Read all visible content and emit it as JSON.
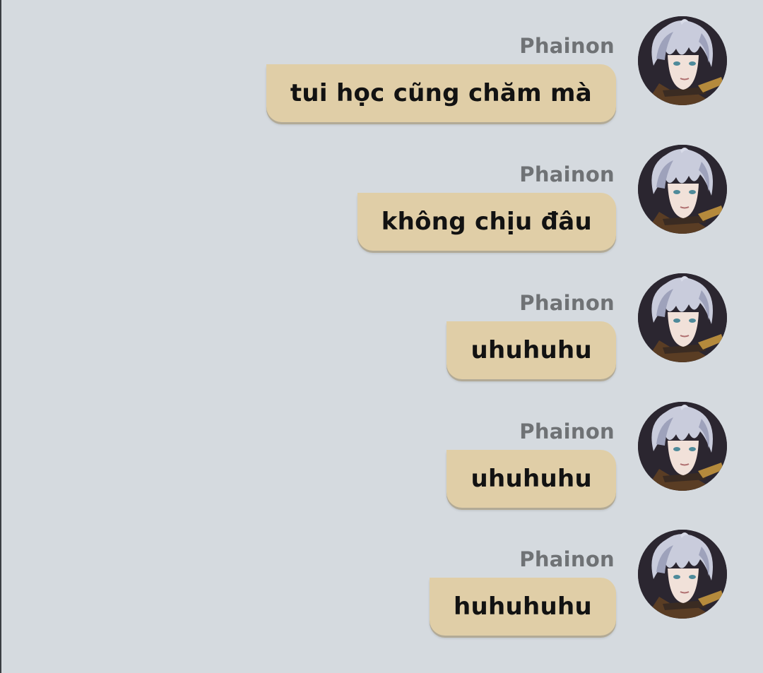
{
  "colors": {
    "background": "#d5dadf",
    "bubble": "#e0cea7",
    "sender_text": "#6f7275",
    "message_text": "#121212"
  },
  "messages": [
    {
      "sender": "Phainon",
      "text": "tui học cũng chăm mà",
      "avatar": "phainon-avatar"
    },
    {
      "sender": "Phainon",
      "text": "không chịu đâu",
      "avatar": "phainon-avatar"
    },
    {
      "sender": "Phainon",
      "text": "uhuhuhu",
      "avatar": "phainon-avatar"
    },
    {
      "sender": "Phainon",
      "text": "uhuhuhu",
      "avatar": "phainon-avatar"
    },
    {
      "sender": "Phainon",
      "text": "huhuhuhu",
      "avatar": "phainon-avatar"
    }
  ]
}
